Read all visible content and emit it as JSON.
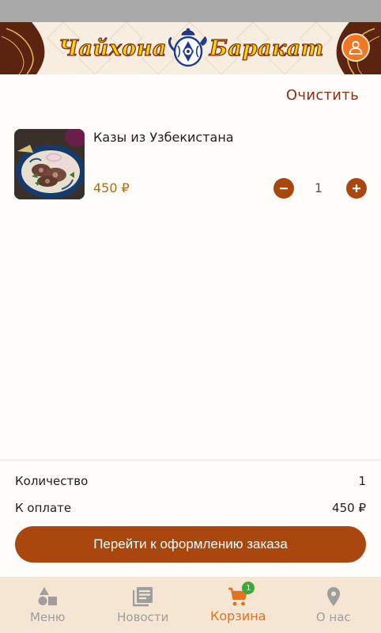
{
  "header": {
    "logo_left": "Чайхона",
    "logo_right": "Баракат"
  },
  "cart": {
    "clear_label": "Очистить",
    "items": [
      {
        "title": "Казы из Узбекистана",
        "price": "450 ₽",
        "quantity": "1"
      }
    ]
  },
  "summary": {
    "quantity_label": "Количество",
    "quantity_value": "1",
    "total_label": "К оплате",
    "total_value": "450 ₽",
    "checkout_label": "Перейти к оформлению заказа"
  },
  "nav": {
    "items": [
      {
        "label": "Меню",
        "icon": "shapes-icon"
      },
      {
        "label": "Новости",
        "icon": "newspaper-icon"
      },
      {
        "label": "Корзина",
        "icon": "cart-icon",
        "badge": "1",
        "active": true
      },
      {
        "label": "О нас",
        "icon": "location-pin-icon"
      }
    ]
  },
  "colors": {
    "accent": "#a9470f",
    "active_nav": "#e07220",
    "badge": "#3da63d",
    "price": "#b06a12"
  }
}
